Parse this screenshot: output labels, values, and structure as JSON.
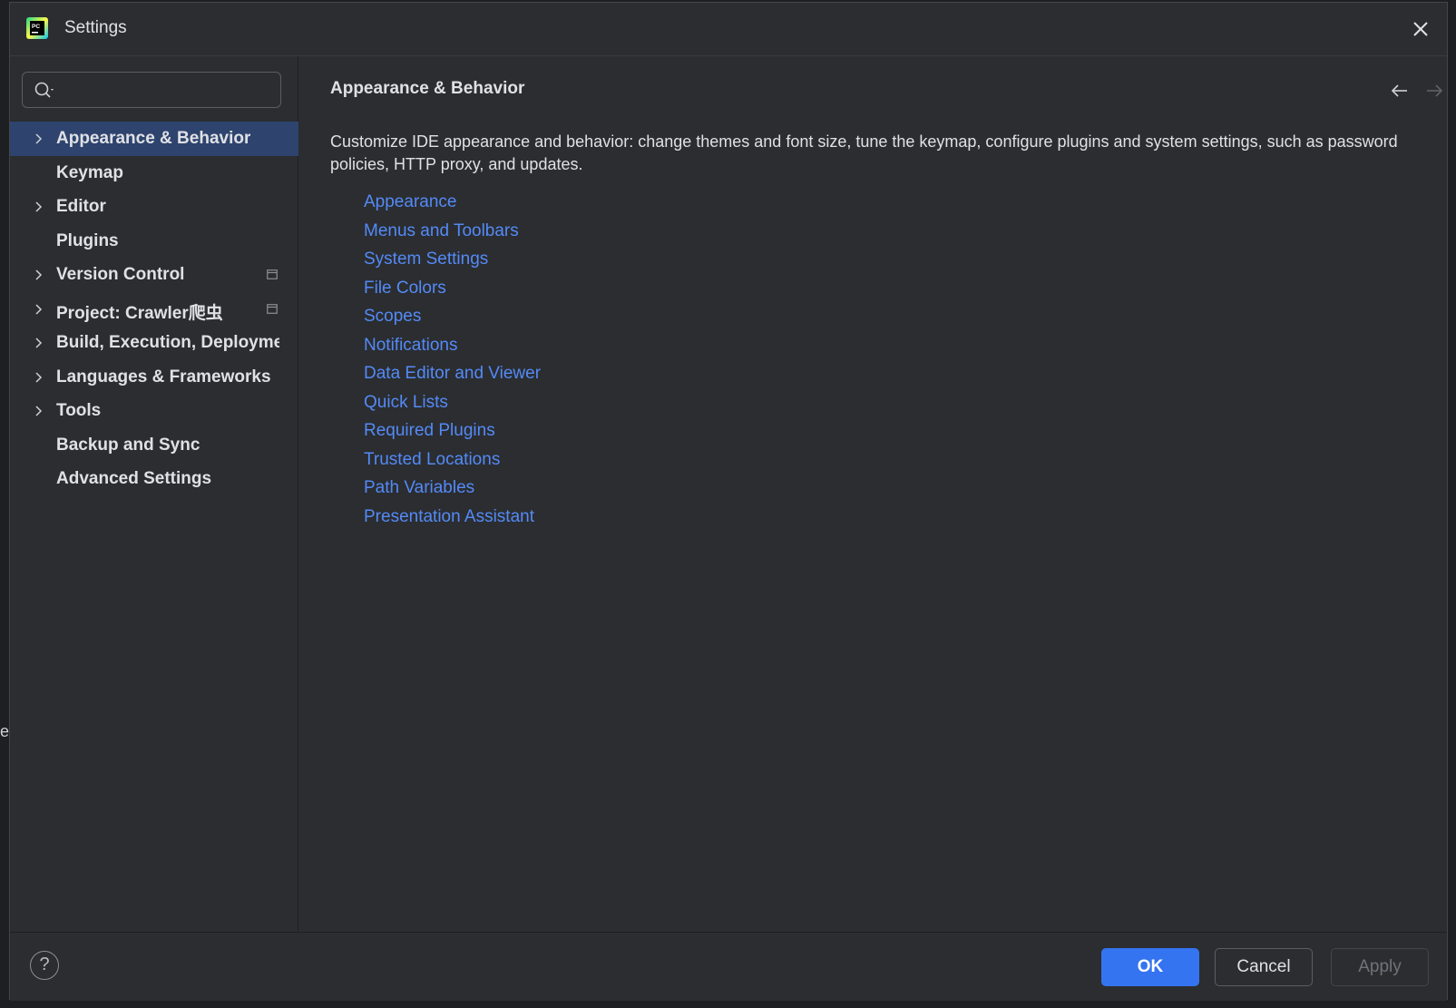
{
  "backdrop": {
    "edge_text": "e"
  },
  "window": {
    "title": "Settings",
    "logo_icon": "pycharm-logo-icon",
    "close_icon": "close-icon"
  },
  "sidebar": {
    "search": {
      "value": "",
      "placeholder": ""
    },
    "items": [
      {
        "label": "Appearance & Behavior",
        "expandable": true,
        "selected": true,
        "badge": false
      },
      {
        "label": "Keymap",
        "expandable": false,
        "selected": false,
        "badge": false
      },
      {
        "label": "Editor",
        "expandable": true,
        "selected": false,
        "badge": false
      },
      {
        "label": "Plugins",
        "expandable": false,
        "selected": false,
        "badge": false
      },
      {
        "label": "Version Control",
        "expandable": true,
        "selected": false,
        "badge": true
      },
      {
        "label": "Project: Crawler爬虫",
        "expandable": true,
        "selected": false,
        "badge": true
      },
      {
        "label": "Build, Execution, Deployment",
        "expandable": true,
        "selected": false,
        "badge": false
      },
      {
        "label": "Languages & Frameworks",
        "expandable": true,
        "selected": false,
        "badge": false
      },
      {
        "label": "Tools",
        "expandable": true,
        "selected": false,
        "badge": false
      },
      {
        "label": "Backup and Sync",
        "expandable": false,
        "selected": false,
        "badge": false
      },
      {
        "label": "Advanced Settings",
        "expandable": false,
        "selected": false,
        "badge": false
      }
    ]
  },
  "main": {
    "title": "Appearance & Behavior",
    "description": "Customize IDE appearance and behavior: change themes and font size, tune the keymap, configure plugins and system settings, such as password policies, HTTP proxy, and updates.",
    "links": [
      "Appearance",
      "Menus and Toolbars",
      "System Settings",
      "File Colors",
      "Scopes",
      "Notifications",
      "Data Editor and Viewer",
      "Quick Lists",
      "Required Plugins",
      "Trusted Locations",
      "Path Variables",
      "Presentation Assistant"
    ]
  },
  "footer": {
    "help_label": "?",
    "ok_label": "OK",
    "cancel_label": "Cancel",
    "apply_label": "Apply"
  },
  "colors": {
    "background": "#2b2d30",
    "selection": "#2e436e",
    "link": "#548af7",
    "accent": "#3574f0",
    "text": "#dfe1e5"
  }
}
